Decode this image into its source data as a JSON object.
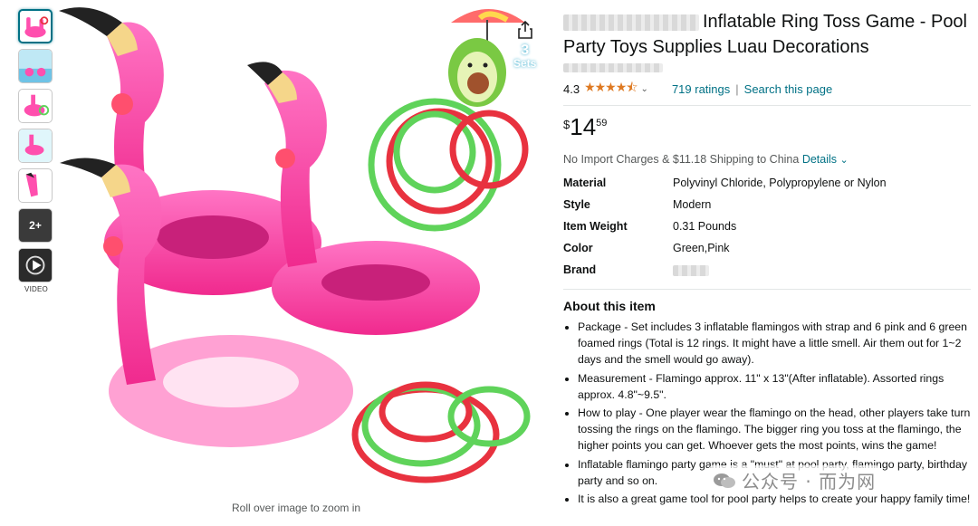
{
  "gallery": {
    "thumbnails": [
      "thumb-1",
      "thumb-2",
      "thumb-3",
      "thumb-4",
      "thumb-5",
      "thumb-6",
      "thumb-7"
    ],
    "more_count": "2+",
    "video_label": "VIDEO",
    "badge_number": "3",
    "badge_text": "Sets",
    "zoom_hint": "Roll over image to zoom in"
  },
  "product": {
    "title": "Inflatable Ring Toss Game - Pool Party Toys Supplies Luau Decorations",
    "rating": "4.3",
    "stars": "★★★★⯪",
    "ratings_count": "719 ratings",
    "search_link": "Search this page",
    "price_symbol": "$",
    "price_whole": "14",
    "price_fraction": "59",
    "shipping_text": "No Import Charges & $11.18 Shipping to China",
    "shipping_link": "Details"
  },
  "specs": [
    {
      "key": "Material",
      "value": "Polyvinyl Chloride, Polypropylene or Nylon"
    },
    {
      "key": "Style",
      "value": "Modern"
    },
    {
      "key": "Item Weight",
      "value": "0.31 Pounds"
    },
    {
      "key": "Color",
      "value": "Green,Pink"
    },
    {
      "key": "Brand",
      "value": ""
    }
  ],
  "about": {
    "heading": "About this item",
    "bullets": [
      "Package - Set includes 3 inflatable flamingos with strap and 6 pink and 6 green foamed rings (Total is 12 rings. It might have a little smell. Air them out for 1~2 days and the smell would go away).",
      "Measurement - Flamingo approx. 11\" x 13\"(After inflatable). Assorted rings approx. 4.8\"~9.5\".",
      "How to play - One player wear the flamingo on the head, other players take turn tossing the rings on the flamingo. The bigger ring you toss at the flamingo, the higher points you can get. Whoever gets the most points, wins the game!",
      "Inflatable flamingo party game is a \"must\" at pool party, flamingo party, birthday party and so on.",
      "It is also a great game tool for pool party helps to create your happy family time!"
    ]
  },
  "watermark": {
    "text": "公众号 · 而为网"
  },
  "colors": {
    "link": "#007185",
    "star": "#de7921",
    "pink": "#ff3fa4",
    "green": "#5fd35a",
    "red": "#e8323f"
  }
}
